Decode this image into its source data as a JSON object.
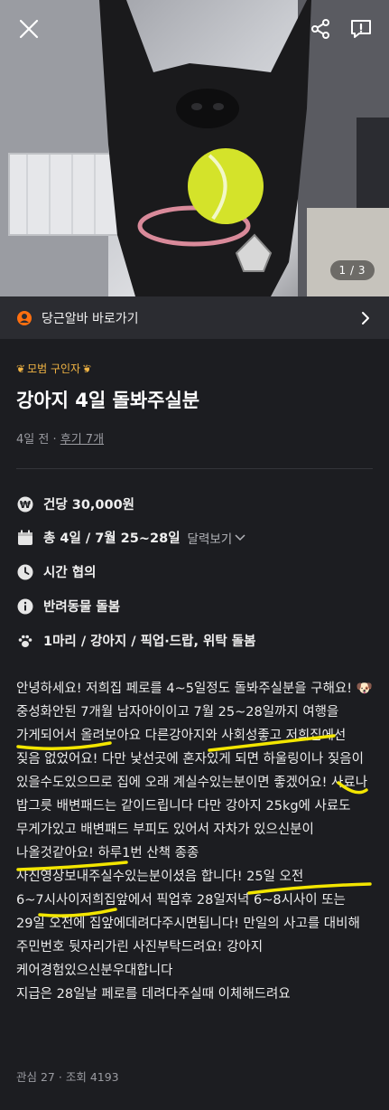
{
  "header": {
    "close_icon": "close-icon",
    "share_icon": "share-icon",
    "report_icon": "report-icon",
    "image_counter": "1 / 3"
  },
  "banner": {
    "icon": "daangn-alba-icon",
    "label": "당근알바 바로가기",
    "chevron": "chevron-right-icon"
  },
  "post": {
    "badge": "모범 구인자",
    "title": "강아지 4일 돌봐주실분",
    "posted": "4일 전",
    "separator": "·",
    "reviews": "후기 7개"
  },
  "details": {
    "pay": "건당 30,000원",
    "schedule": "총 4일 / 7월 25~28일",
    "calendar_link": "달력보기",
    "time": "시간 협의",
    "category": "반려동물 돌봄",
    "pet": "1마리 / 강아지 / 픽업·드랍, 위탁 돌봄"
  },
  "description": "안녕하세요! 저희집 페로를 4~5일정도 돌봐주실분을 구해요! 🐶\n중성화안된 7개월 남자아이이고 7월 25~28일까지 여행을 가게되어서 올려보아요 다른강아지와 사회성좋고 저희집에선 짖음 없었어요! 다만 낯선곳에 혼자있게 되면 하울링이나 짖음이 있을수도있으므로 집에 오래 계실수있는분이면 좋겠어요! 사료나 밥그릇 배변패드는 같이드립니다 다만 강아지 25kg에 사료도 무게가있고 배변패드 부피도 있어서 자차가 있으신분이 나올것같아요! 하루1번 산책 종종 사진영상보내주실수있는분이셨음 합니다! 25일 오전 6~7시사이저희집앞에서 픽업후 28일저녁 6~8시사이 또는 29일 오전에 집앞에데려다주시면됩니다! 만일의 사고를 대비해 주민번호 뒷자리가린 사진부탁드려요! 강아지 케어경험있으신분우대합니다\n지급은 28일날 페로를 데려다주실때 이체해드려요",
  "stats": {
    "interest": "관심 27",
    "dot": "·",
    "views": "조회 4193"
  },
  "colors": {
    "background": "#1c1d21",
    "accent": "#ff6f0f",
    "badge": "#f2b544",
    "highlight": "#f3e600"
  }
}
